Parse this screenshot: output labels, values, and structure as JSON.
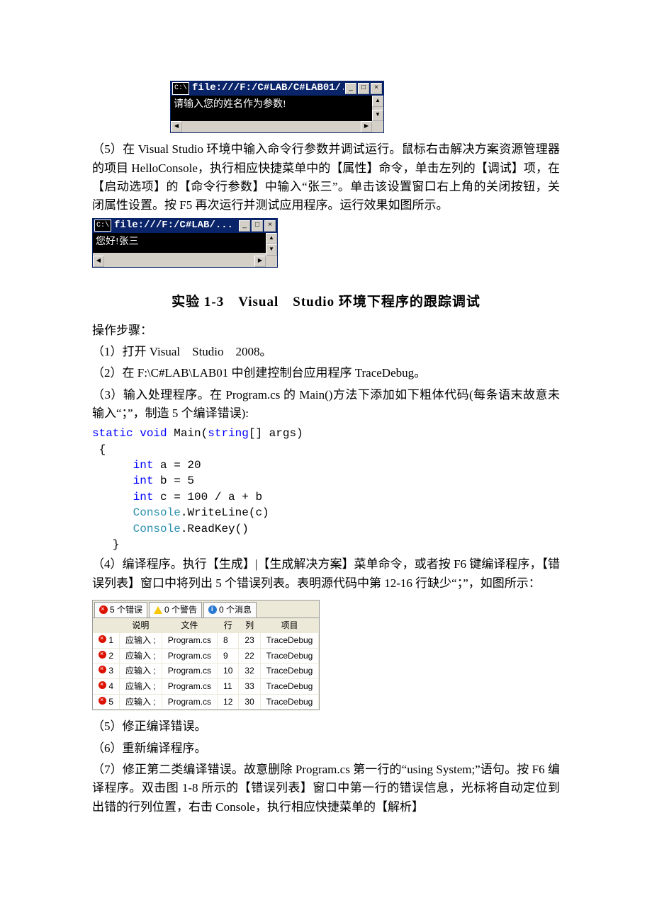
{
  "console1": {
    "title": "file:///F:/C#LAB/C#LAB01/...",
    "text": "请输入您的姓名作为参数!"
  },
  "para5": "（5）在 Visual Studio 环境中输入命令行参数并调试运行。鼠标右击解决方案资源管理器的项目 HelloConsole，执行相应快捷菜单中的【属性】命令，单击左列的【调试】项，在【启动选项】的【命令行参数】中输入“张三”。单击该设置窗口右上角的关闭按钮，关闭属性设置。按 F5 再次运行并测试应用程序。运行效果如图所示。",
  "console2": {
    "title": "file:///F:/C#LAB/...",
    "text": "您好!张三"
  },
  "heading": "实验 1-3 Visual Studio 环境下程序的跟踪调试",
  "steps_label": "操作步骤：",
  "step1": "（1）打开 Visual Studio 2008。",
  "step2": "（2）在 F:\\C#LAB\\LAB01 中创建控制台应用程序 TraceDebug。",
  "step3": "（3）输入处理程序。在 Program.cs 的 Main()方法下添加如下粗体代码(每条语末故意未输入“；”，制造 5 个编译错误):",
  "code": {
    "l1a": "static void",
    "l1b": " Main(",
    "l1c": "string",
    "l1d": "[] args)",
    "l2": " {",
    "l3a": "int",
    "l3b": " a = 20",
    "l4a": "int",
    "l4b": " b = 5",
    "l5a": "int",
    "l5b": " c = 100 / a + b",
    "l6a": "Console",
    "l6b": ".WriteLine(c)",
    "l7a": "Console",
    "l7b": ".ReadKey()",
    "l8": "   }"
  },
  "step4": "（4）编译程序。执行【生成】|【生成解决方案】菜单命令，或者按 F6 键编译程序，【错误列表】窗口中将列出 5 个错误列表。表明源代码中第 12-16 行缺少“；”，如图所示：",
  "errlist": {
    "tab_err": "5 个错误",
    "tab_warn": "0 个警告",
    "tab_info": "0 个消息",
    "headers": {
      "desc": "说明",
      "file": "文件",
      "line": "行",
      "col": "列",
      "proj": "项目"
    },
    "rows": [
      {
        "n": "1",
        "desc": "应输入 ;",
        "file": "Program.cs",
        "line": "8",
        "col": "23",
        "proj": "TraceDebug"
      },
      {
        "n": "2",
        "desc": "应输入 ;",
        "file": "Program.cs",
        "line": "9",
        "col": "22",
        "proj": "TraceDebug"
      },
      {
        "n": "3",
        "desc": "应输入 ;",
        "file": "Program.cs",
        "line": "10",
        "col": "32",
        "proj": "TraceDebug"
      },
      {
        "n": "4",
        "desc": "应输入 ;",
        "file": "Program.cs",
        "line": "11",
        "col": "33",
        "proj": "TraceDebug"
      },
      {
        "n": "5",
        "desc": "应输入 ;",
        "file": "Program.cs",
        "line": "12",
        "col": "30",
        "proj": "TraceDebug"
      }
    ]
  },
  "step5_b": "（5）修正编译错误。",
  "step6": "（6）重新编译程序。",
  "step7": "（7）修正第二类编译错误。故意删除 Program.cs 第一行的“using System;”语句。按 F6 编译程序。双击图 1-8 所示的【错误列表】窗口中第一行的错误信息，光标将自动定位到出错的行列位置，右击 Console，执行相应快捷菜单的【解析】"
}
